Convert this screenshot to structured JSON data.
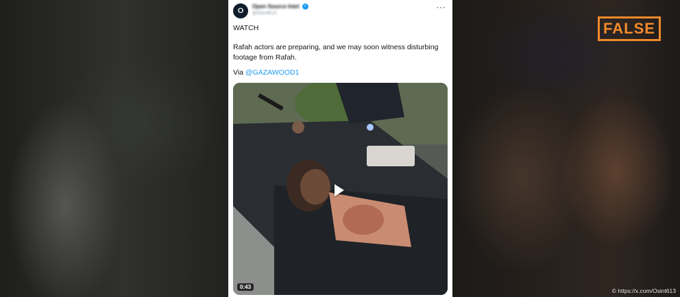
{
  "badge": {
    "label": "FALSE",
    "color": "#f18a2b"
  },
  "credit": {
    "text": "© https://x.com/Osint613"
  },
  "tweet": {
    "avatar_initial": "O",
    "author_name": "Open Source Intel",
    "author_handle": "@Osint613",
    "more_icon": "more-horizontal-icon",
    "lines": {
      "watch": "WATCH",
      "body": "Rafah actors are preparing, and we may soon witness disturbing footage from Rafah.",
      "via_prefix": "Via ",
      "mention": "@GAZAWOOD1"
    },
    "video": {
      "duration": "0:43",
      "play_icon": "play-icon"
    }
  },
  "colors": {
    "link": "#1d9bf0",
    "card_bg": "#ffffff",
    "text": "#0f1419"
  }
}
